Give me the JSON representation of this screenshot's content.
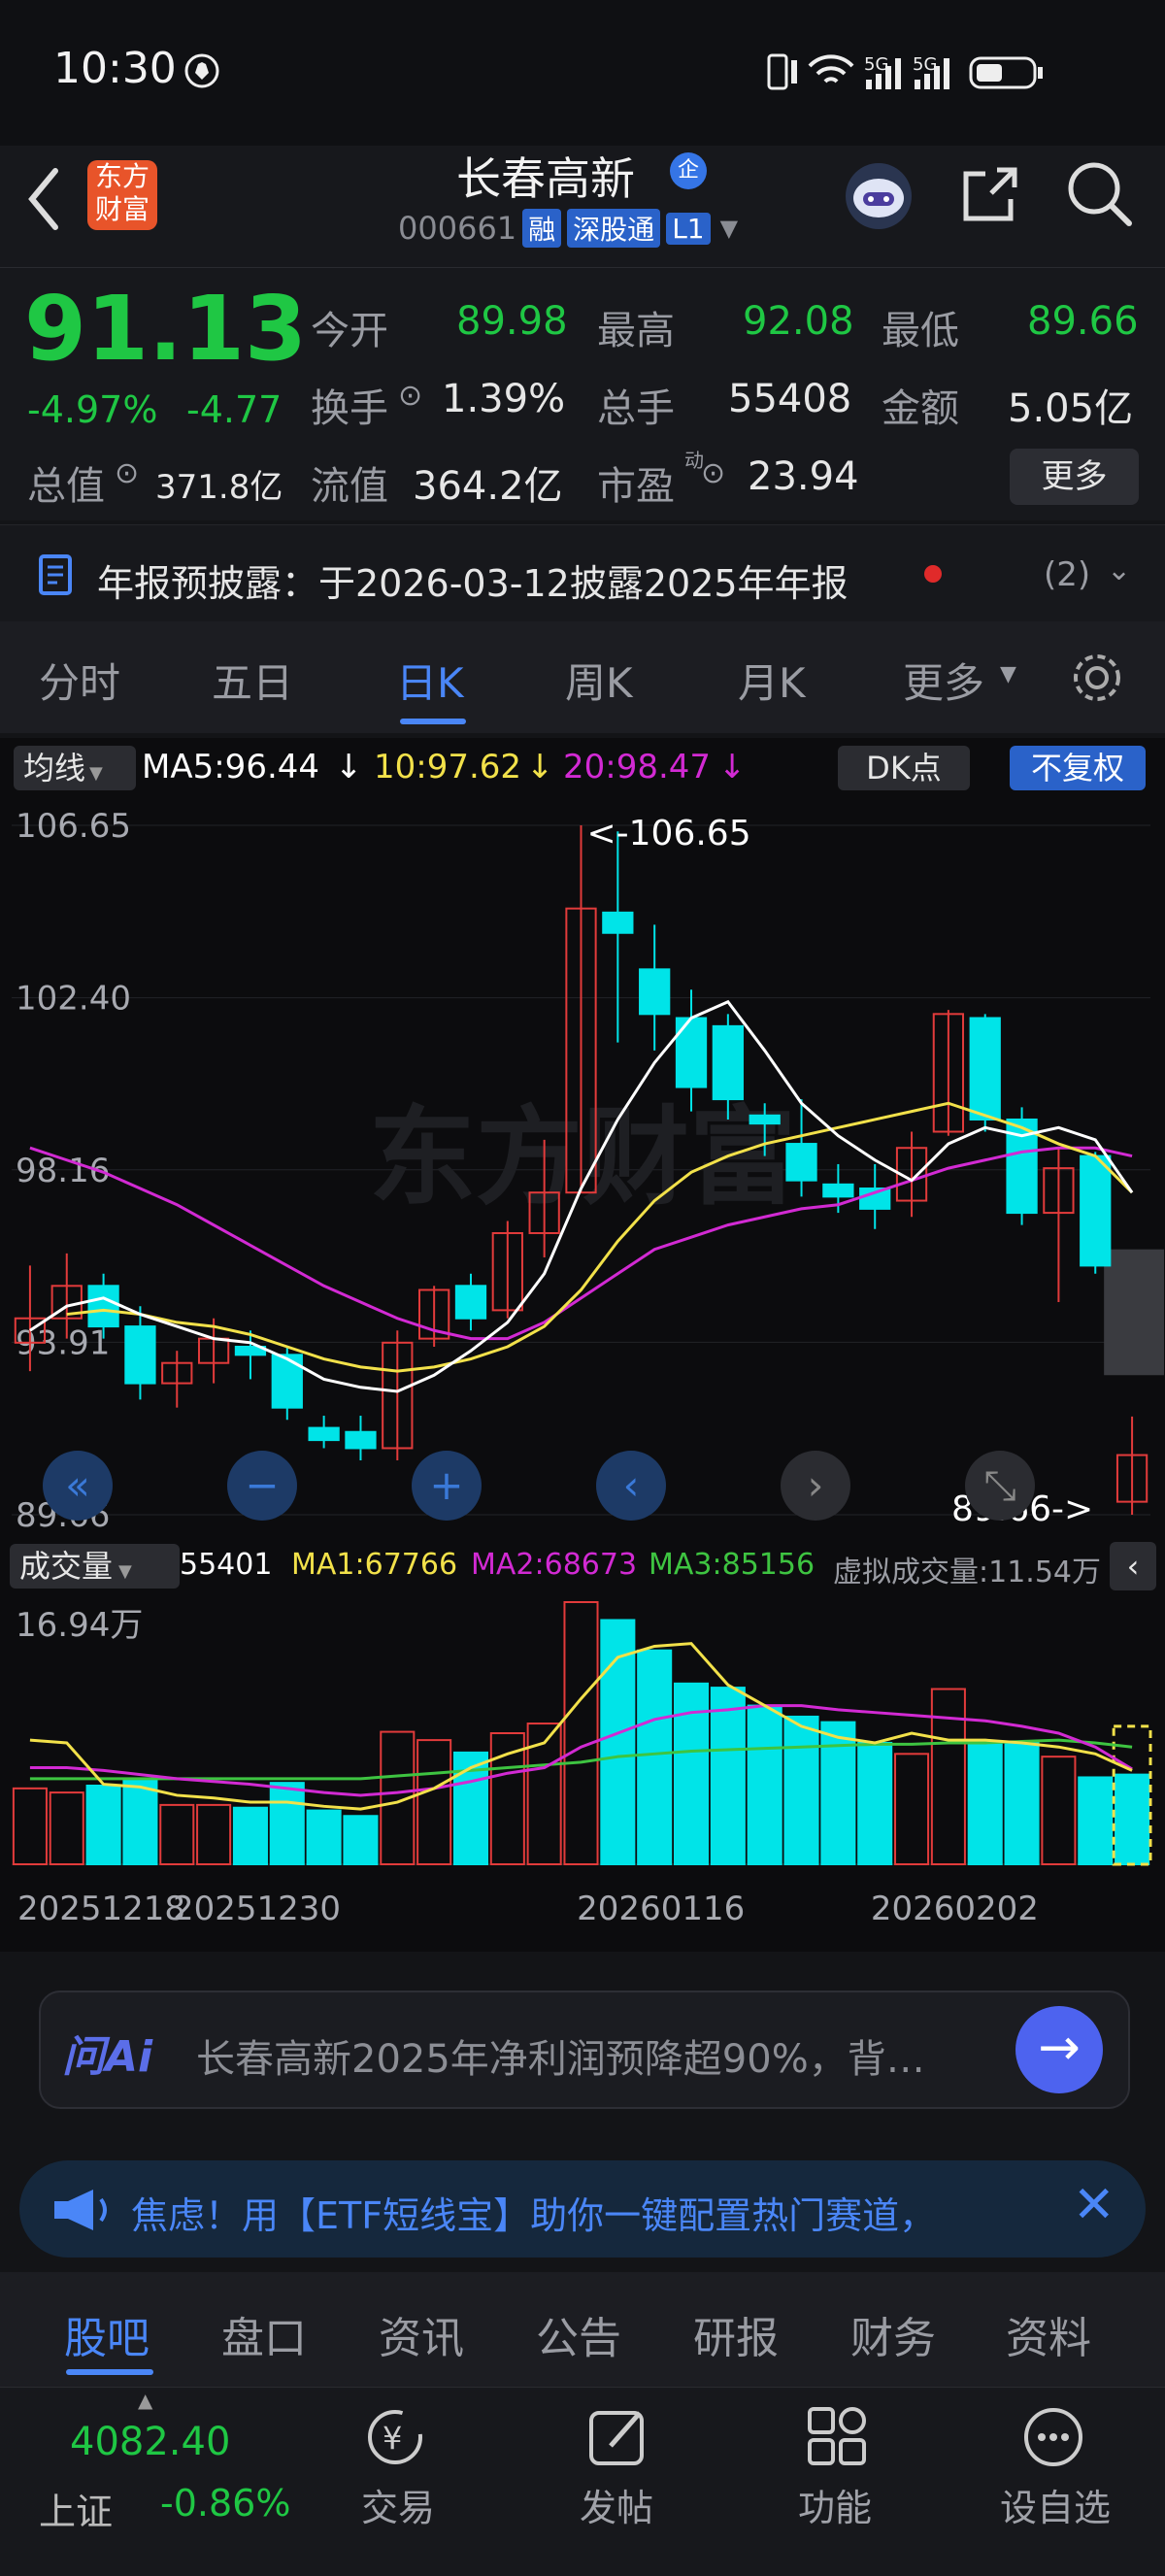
{
  "status": {
    "time": "10:30"
  },
  "header": {
    "brand_text": "东方财富",
    "title": "长春高新",
    "title_badge": "企",
    "code": "000661",
    "tags": [
      "融",
      "深股通",
      "L1"
    ]
  },
  "quote": {
    "price": "91.13",
    "change_pct": "-4.97%",
    "change": "-4.77",
    "fields": [
      {
        "label": "今开",
        "value": "89.98"
      },
      {
        "label": "最高",
        "value": "92.08"
      },
      {
        "label": "最低",
        "value": "89.66"
      },
      {
        "label": "换手",
        "value": "1.39%"
      },
      {
        "label": "总手",
        "value": "55408"
      },
      {
        "label": "金额",
        "value": "5.05亿"
      },
      {
        "label": "总值",
        "value": "371.8亿"
      },
      {
        "label": "流值",
        "value": "364.2亿"
      },
      {
        "label": "市盈",
        "value": "23.94"
      }
    ],
    "pe_super": "动",
    "more_label": "更多"
  },
  "notice": {
    "text": "年报预披露：于2026-03-12披露2025年年报",
    "count": "(2)"
  },
  "tabs": [
    "分时",
    "五日",
    "日K",
    "周K",
    "月K",
    "更多"
  ],
  "active_tab": "日K",
  "chart_header": {
    "ma_select": "均线",
    "ma5": "MA5:96.44",
    "ma10": "10:97.62",
    "ma20": "20:98.47",
    "dk_label": "DK点",
    "adjust_label": "不复权"
  },
  "vol_header": {
    "select": "成交量",
    "vol": "55401",
    "ma1": "MA1:67766",
    "ma2": "MA2:68673",
    "ma3": "MA3:85156",
    "virtual": "虚拟成交量:11.54万"
  },
  "chart_data": {
    "type": "candlestick",
    "y_ticks": [
      "106.65",
      "102.40",
      "98.16",
      "93.91",
      "89.66"
    ],
    "ylim": [
      89.66,
      106.65
    ],
    "max_label": "<-106.65",
    "min_label": "89.66->",
    "vol_max_label": "16.94万",
    "x_labels": [
      "20251218",
      "20251230",
      "20260116",
      "20260202"
    ],
    "colors": {
      "up": "#e23b3b",
      "down": "#00e4e8",
      "ma5": "#ffffff",
      "ma10": "#f2e14a",
      "ma20": "#d22ad3",
      "vol_ma3": "#3ec441"
    },
    "candles": [
      {
        "o": 93.9,
        "h": 95.8,
        "l": 93.2,
        "c": 94.5
      },
      {
        "o": 94.5,
        "h": 96.1,
        "l": 94.0,
        "c": 95.3
      },
      {
        "o": 95.3,
        "h": 95.6,
        "l": 94.0,
        "c": 94.3
      },
      {
        "o": 94.3,
        "h": 94.8,
        "l": 92.5,
        "c": 92.9
      },
      {
        "o": 92.9,
        "h": 93.7,
        "l": 92.3,
        "c": 93.4
      },
      {
        "o": 93.4,
        "h": 94.5,
        "l": 92.9,
        "c": 94.0
      },
      {
        "o": 93.8,
        "h": 94.2,
        "l": 93.0,
        "c": 93.6
      },
      {
        "o": 93.6,
        "h": 93.8,
        "l": 92.0,
        "c": 92.3
      },
      {
        "o": 91.8,
        "h": 92.1,
        "l": 91.3,
        "c": 91.5
      },
      {
        "o": 91.7,
        "h": 92.1,
        "l": 91.0,
        "c": 91.3
      },
      {
        "o": 91.3,
        "h": 94.2,
        "l": 91.0,
        "c": 93.9
      },
      {
        "o": 94.0,
        "h": 95.3,
        "l": 93.8,
        "c": 95.2
      },
      {
        "o": 95.3,
        "h": 95.6,
        "l": 94.2,
        "c": 94.5
      },
      {
        "o": 94.7,
        "h": 96.9,
        "l": 94.5,
        "c": 96.6
      },
      {
        "o": 96.6,
        "h": 98.9,
        "l": 96.0,
        "c": 97.6
      },
      {
        "o": 97.6,
        "h": 106.65,
        "l": 97.6,
        "c": 104.6
      },
      {
        "o": 104.5,
        "h": 106.5,
        "l": 101.3,
        "c": 104.0
      },
      {
        "o": 103.1,
        "h": 104.2,
        "l": 101.1,
        "c": 102.0
      },
      {
        "o": 101.9,
        "h": 102.6,
        "l": 99.6,
        "c": 100.2
      },
      {
        "o": 101.7,
        "h": 102.0,
        "l": 99.4,
        "c": 99.9
      },
      {
        "o": 99.5,
        "h": 99.8,
        "l": 98.5,
        "c": 99.3
      },
      {
        "o": 98.8,
        "h": 99.9,
        "l": 97.5,
        "c": 97.9
      },
      {
        "o": 97.8,
        "h": 98.3,
        "l": 97.1,
        "c": 97.5
      },
      {
        "o": 97.7,
        "h": 98.3,
        "l": 96.7,
        "c": 97.2
      },
      {
        "o": 97.4,
        "h": 99.1,
        "l": 97.0,
        "c": 98.7
      },
      {
        "o": 99.1,
        "h": 102.1,
        "l": 99.0,
        "c": 102.0
      },
      {
        "o": 101.9,
        "h": 102.0,
        "l": 99.1,
        "c": 99.4
      },
      {
        "o": 99.4,
        "h": 99.7,
        "l": 96.8,
        "c": 97.1
      },
      {
        "o": 97.1,
        "h": 98.7,
        "l": 94.9,
        "c": 98.2
      },
      {
        "o": 98.5,
        "h": 98.6,
        "l": 95.6,
        "c": 95.8
      },
      {
        "o": 89.98,
        "h": 92.08,
        "l": 89.66,
        "c": 91.13
      }
    ],
    "ma5": [
      94.2,
      94.8,
      95.0,
      94.6,
      94.3,
      94.0,
      93.9,
      93.5,
      93.0,
      92.8,
      92.7,
      93.1,
      93.7,
      94.4,
      95.6,
      97.7,
      99.4,
      100.8,
      101.9,
      102.3,
      101.1,
      99.8,
      99.0,
      98.4,
      97.9,
      98.8,
      99.2,
      99.0,
      99.2,
      98.9,
      97.6
    ],
    "ma10": [
      null,
      94.6,
      94.7,
      94.6,
      94.4,
      94.3,
      94.1,
      93.8,
      93.5,
      93.3,
      93.2,
      93.3,
      93.5,
      93.8,
      94.3,
      95.2,
      96.4,
      97.4,
      98.1,
      98.5,
      98.8,
      99.0,
      99.2,
      99.4,
      99.6,
      99.8,
      99.5,
      99.2,
      98.8,
      98.5,
      97.6
    ],
    "ma20": [
      98.7,
      98.4,
      98.1,
      97.7,
      97.3,
      96.8,
      96.3,
      95.8,
      95.3,
      94.9,
      94.5,
      94.2,
      94.0,
      94.0,
      94.4,
      95.0,
      95.6,
      96.2,
      96.5,
      96.8,
      97.0,
      97.2,
      97.3,
      97.6,
      97.9,
      98.2,
      98.4,
      98.6,
      98.7,
      98.7,
      98.5
    ],
    "volumes": [
      {
        "v": 55,
        "up": true
      },
      {
        "v": 52,
        "up": true
      },
      {
        "v": 57,
        "up": false
      },
      {
        "v": 61,
        "up": false
      },
      {
        "v": 43,
        "up": true
      },
      {
        "v": 43,
        "up": true
      },
      {
        "v": 41,
        "up": false
      },
      {
        "v": 59,
        "up": false
      },
      {
        "v": 39,
        "up": false
      },
      {
        "v": 35,
        "up": false
      },
      {
        "v": 96,
        "up": true
      },
      {
        "v": 90,
        "up": true
      },
      {
        "v": 81,
        "up": false
      },
      {
        "v": 95,
        "up": true
      },
      {
        "v": 102,
        "up": true
      },
      {
        "v": 190,
        "up": true
      },
      {
        "v": 177,
        "up": false
      },
      {
        "v": 155,
        "up": false
      },
      {
        "v": 131,
        "up": false
      },
      {
        "v": 128,
        "up": false
      },
      {
        "v": 115,
        "up": false
      },
      {
        "v": 107,
        "up": false
      },
      {
        "v": 103,
        "up": false
      },
      {
        "v": 88,
        "up": false
      },
      {
        "v": 80,
        "up": true
      },
      {
        "v": 127,
        "up": true
      },
      {
        "v": 88,
        "up": false
      },
      {
        "v": 88,
        "up": false
      },
      {
        "v": 78,
        "up": true
      },
      {
        "v": 63,
        "up": false
      },
      {
        "v": 65,
        "up": false
      }
    ],
    "vol_ma1": [
      90,
      88,
      58,
      56,
      50,
      48,
      45,
      45,
      42,
      40,
      45,
      55,
      70,
      80,
      88,
      120,
      150,
      158,
      160,
      130,
      115,
      100,
      92,
      88,
      95,
      90,
      90,
      88,
      85,
      80,
      68
    ],
    "vol_ma2": [
      70,
      70,
      68,
      65,
      62,
      60,
      58,
      55,
      52,
      50,
      52,
      55,
      60,
      66,
      70,
      85,
      95,
      105,
      110,
      112,
      115,
      115,
      112,
      110,
      108,
      106,
      104,
      100,
      95,
      85,
      69
    ],
    "vol_ma3": [
      62,
      62,
      62,
      62,
      62,
      62,
      62,
      62,
      62,
      62,
      64,
      66,
      68,
      70,
      72,
      74,
      78,
      80,
      82,
      83,
      84,
      85,
      86,
      87,
      87,
      88,
      88,
      89,
      90,
      88,
      85
    ]
  },
  "ai": {
    "brand": "问Ai",
    "text": "长春高新2025年净利润预降超90%，背…"
  },
  "ad": {
    "text": "焦虑！用【ETF短线宝】助你一键配置热门赛道，"
  },
  "bottom_tabs": [
    "股吧",
    "盘口",
    "资讯",
    "公告",
    "研报",
    "财务",
    "资料"
  ],
  "active_bottom_tab": "股吧",
  "index": {
    "value": "4082.40",
    "name": "上证",
    "change": "-0.86%"
  },
  "nav": [
    "交易",
    "发帖",
    "功能",
    "设自选"
  ]
}
